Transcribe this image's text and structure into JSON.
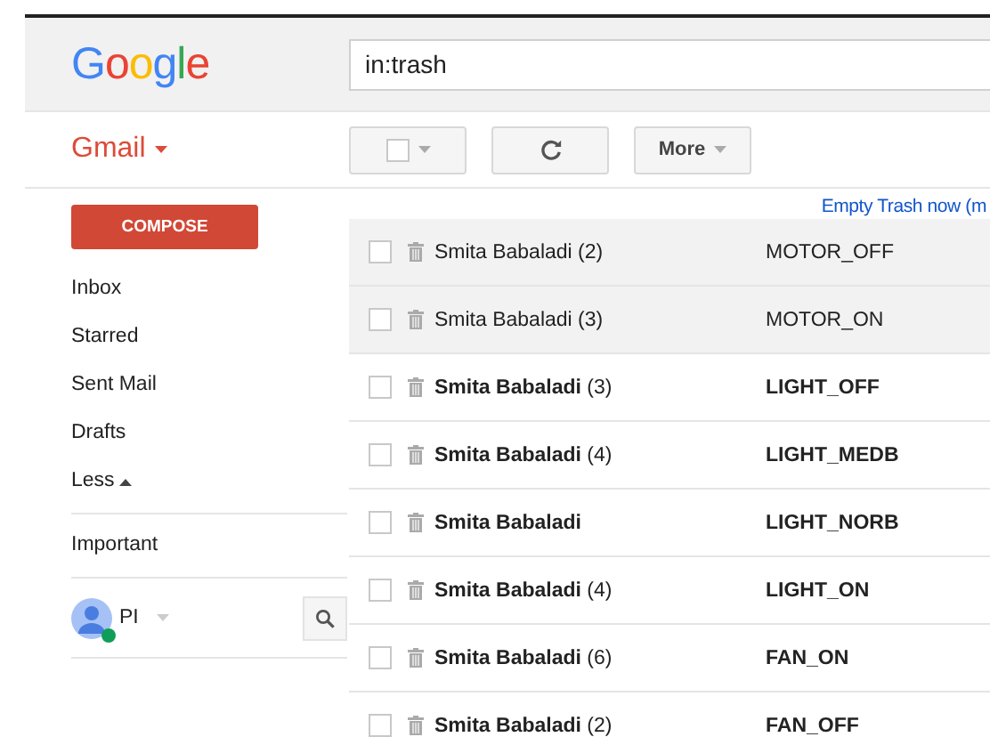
{
  "header": {
    "logo": "Google",
    "search": {
      "value": "in:trash"
    }
  },
  "toolbar": {
    "app_menu": "Gmail",
    "select_checked": false,
    "more": "More"
  },
  "sidebar": {
    "compose": "COMPOSE",
    "items": [
      {
        "label": "Inbox"
      },
      {
        "label": "Starred"
      },
      {
        "label": "Sent Mail"
      },
      {
        "label": "Drafts"
      }
    ],
    "less": "Less",
    "important": "Important",
    "account": {
      "initials": "PI",
      "online": true
    }
  },
  "empty_trash": "Empty Trash now (m",
  "messages": [
    {
      "sender": "Smita Babaladi",
      "count": "(2)",
      "subject": "MOTOR_OFF",
      "read": true,
      "checked": false
    },
    {
      "sender": "Smita Babaladi",
      "count": "(3)",
      "subject": "MOTOR_ON",
      "read": true,
      "checked": false
    },
    {
      "sender": "Smita Babaladi",
      "count": "(3)",
      "subject": "LIGHT_OFF",
      "read": false,
      "checked": false
    },
    {
      "sender": "Smita Babaladi",
      "count": "(4)",
      "subject": "LIGHT_MEDB",
      "read": false,
      "checked": false
    },
    {
      "sender": "Smita Babaladi",
      "subject": "LIGHT_NORB",
      "read": false,
      "checked": false
    },
    {
      "sender": "Smita Babaladi",
      "count": "(4)",
      "subject": "LIGHT_ON",
      "read": false,
      "checked": false
    },
    {
      "sender": "Smita Babaladi",
      "count": "(6)",
      "subject": "FAN_ON",
      "read": false,
      "checked": false
    },
    {
      "sender": "Smita Babaladi",
      "count": "(2)",
      "subject": "FAN_OFF",
      "read": false,
      "checked": false
    }
  ]
}
